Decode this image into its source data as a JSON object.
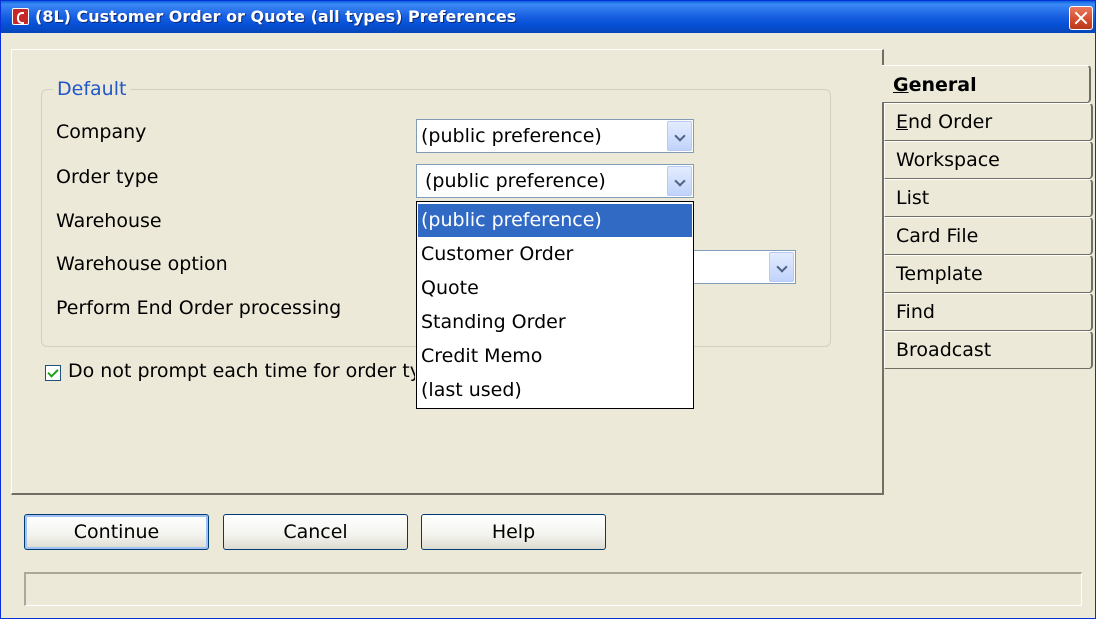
{
  "window": {
    "title": "(8L) Customer Order or Quote  (all types) Preferences"
  },
  "group": {
    "legend": "Default"
  },
  "fields": {
    "company_label": "Company",
    "company_value": "(public preference)",
    "order_type_label": "Order type",
    "order_type_value": "(public preference)",
    "warehouse_label": "Warehouse",
    "warehouse_option_label": "Warehouse option",
    "end_order_label": "Perform End Order processing"
  },
  "dropdown": {
    "options": [
      "(public preference)",
      "Customer Order",
      "Quote",
      "Standing Order",
      "Credit Memo",
      "(last used)"
    ],
    "selected_index": 0
  },
  "checkbox": {
    "label": "Do not prompt each time for order type",
    "checked": true
  },
  "tabs": [
    {
      "key": "G",
      "rest": "eneral",
      "active": true
    },
    {
      "key": "E",
      "rest": "nd Order",
      "active": false
    },
    {
      "key": "",
      "rest": "Workspace",
      "active": false
    },
    {
      "key": "",
      "rest": "List",
      "active": false
    },
    {
      "key": "",
      "rest": "Card File",
      "active": false
    },
    {
      "key": "",
      "rest": "Template",
      "active": false
    },
    {
      "key": "",
      "rest": "Find",
      "active": false
    },
    {
      "key": "",
      "rest": "Broadcast",
      "active": false
    }
  ],
  "buttons": {
    "continue": "Continue",
    "cancel": "Cancel",
    "help": "Help"
  },
  "status": {
    "text": ""
  }
}
